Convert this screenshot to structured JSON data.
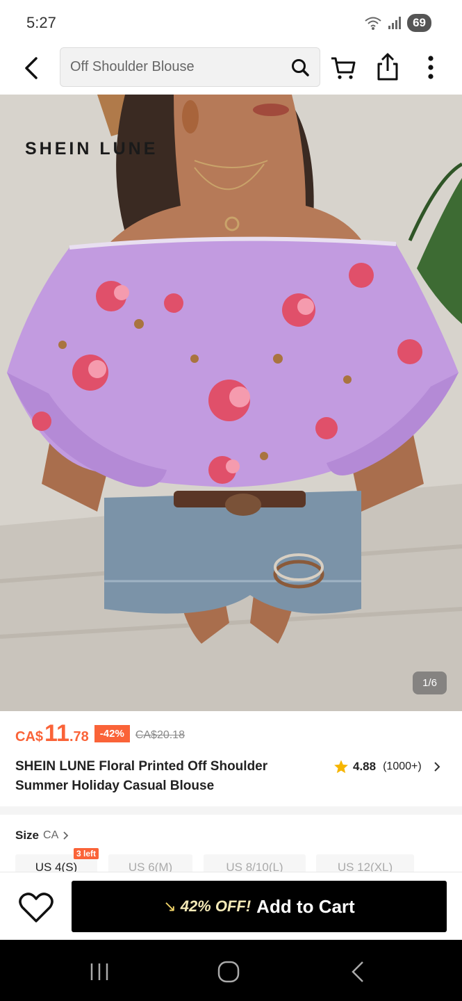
{
  "status_bar": {
    "time": "5:27",
    "battery": "69"
  },
  "search": {
    "placeholder": "Off Shoulder Blouse"
  },
  "hero": {
    "brand_watermark": "SHEIN LUNE",
    "image_counter": "1/6"
  },
  "product": {
    "price_currency": "CA$",
    "price_main": "11",
    "price_cents": ".78",
    "discount": "-42%",
    "original_price": "CA$20.18",
    "title": "SHEIN LUNE Floral Printed Off Shoulder Summer Holiday Casual Blouse",
    "rating": "4.88",
    "rating_count": "(1000+)"
  },
  "size": {
    "label": "Size",
    "region": "CA",
    "options": [
      "US 4(S)",
      "US 6(M)",
      "US 8/10(L)",
      "US 12(XL)"
    ],
    "stock_tag": "3 left"
  },
  "action_bar": {
    "promo": "42% OFF!",
    "add_to_cart": "Add to Cart"
  },
  "colors": {
    "accent": "#fa6338",
    "button": "#000000",
    "promo": "#f4e9b7",
    "star": "#f6b500"
  }
}
